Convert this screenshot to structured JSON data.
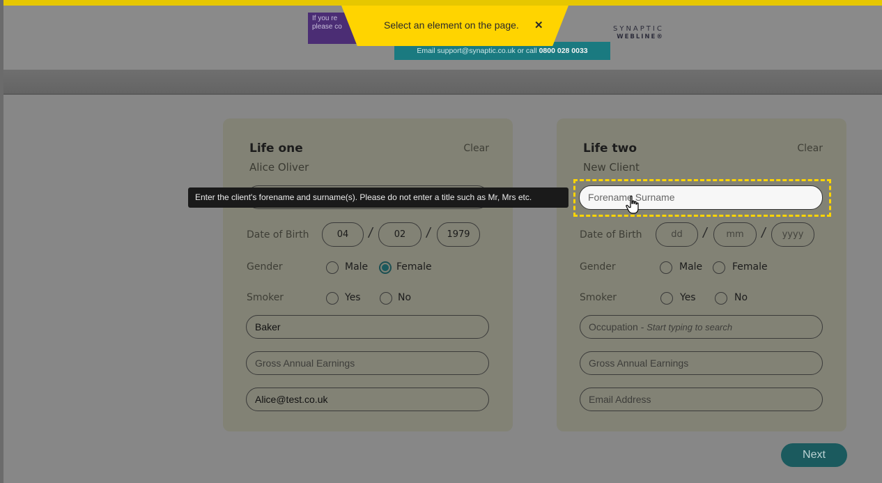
{
  "banner": {
    "purple_line1": "If you re",
    "purple_line2": "please co",
    "support_prefix": "Email support@synaptic.co.uk or call ",
    "support_phone": "0800 028 0033"
  },
  "logo": {
    "line1": "SYNAPTIC",
    "line2": "WEBLINE®"
  },
  "toast": {
    "text": "Select an element on the page.",
    "close_icon": "close-icon"
  },
  "tooltip": {
    "text": "Enter the client's forename and surname(s). Please do not enter a title such as Mr, Mrs etc."
  },
  "life_one": {
    "title": "Life one",
    "subtitle": "Alice Oliver",
    "clear_label": "Clear",
    "dob_label": "Date of Birth",
    "dob_day": "04",
    "dob_month": "02",
    "dob_year": "1979",
    "gender_label": "Gender",
    "gender_male": "Male",
    "gender_female": "Female",
    "smoker_label": "Smoker",
    "smoker_yes": "Yes",
    "smoker_no": "No",
    "occupation_value": "Baker",
    "earnings_placeholder": "Gross Annual Earnings",
    "email_value": "Alice@test.co.uk"
  },
  "life_two": {
    "title": "Life two",
    "subtitle": "New Client",
    "clear_label": "Clear",
    "name_placeholder": "Forename Surname",
    "dob_label": "Date of Birth",
    "dob_day_placeholder": "dd",
    "dob_month_placeholder": "mm",
    "dob_year_placeholder": "yyyy",
    "gender_label": "Gender",
    "gender_male": "Male",
    "gender_female": "Female",
    "smoker_label": "Smoker",
    "smoker_yes": "Yes",
    "smoker_no": "No",
    "occupation_placeholder": "Occupation - ",
    "occupation_hint": "Start typing to search",
    "earnings_placeholder": "Gross Annual Earnings",
    "email_placeholder": "Email Address"
  },
  "date_separator": "/",
  "next_label": "Next",
  "colors": {
    "accent_yellow": "#ffd400",
    "teal": "#1b5a5e",
    "purple": "#4b2d74"
  }
}
